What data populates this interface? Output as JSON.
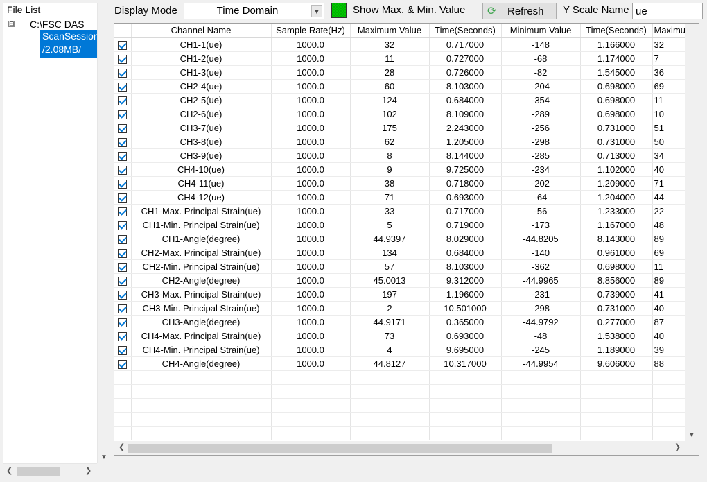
{
  "left_panel": {
    "header": "File List",
    "tree_root_label": "C:\\FSC DAS",
    "tree_expander": "⊟",
    "tree_child_line1": "ScanSession",
    "tree_child_line2": "/2.08MB/"
  },
  "toolbar": {
    "display_mode_label": "Display Mode",
    "display_mode_value": "Time Domain",
    "show_maxmin_label": "Show Max. & Min. Value",
    "show_maxmin_color": "#00c800",
    "refresh_label": "Refresh",
    "refresh_icon": "refresh-icon",
    "y_scale_label": "Y Scale Name",
    "y_scale_value": "ue"
  },
  "grid": {
    "columns": [
      "",
      "Channel Name",
      "Sample Rate(Hz)",
      "Maximum Value",
      "Time(Seconds)",
      "Minimum Value",
      "Time(Seconds)",
      "Maximum Value"
    ],
    "rows": [
      {
        "checked": true,
        "name": "CH1-1(ue)",
        "rate": "1000.0",
        "max": "32",
        "tmax": "0.717000",
        "min": "-148",
        "tmin": "1.166000",
        "extra": "32"
      },
      {
        "checked": true,
        "name": "CH1-2(ue)",
        "rate": "1000.0",
        "max": "11",
        "tmax": "0.727000",
        "min": "-68",
        "tmin": "1.174000",
        "extra": "7"
      },
      {
        "checked": true,
        "name": "CH1-3(ue)",
        "rate": "1000.0",
        "max": "28",
        "tmax": "0.726000",
        "min": "-82",
        "tmin": "1.545000",
        "extra": "36"
      },
      {
        "checked": true,
        "name": "CH2-4(ue)",
        "rate": "1000.0",
        "max": "60",
        "tmax": "8.103000",
        "min": "-204",
        "tmin": "0.698000",
        "extra": "69"
      },
      {
        "checked": true,
        "name": "CH2-5(ue)",
        "rate": "1000.0",
        "max": "124",
        "tmax": "0.684000",
        "min": "-354",
        "tmin": "0.698000",
        "extra": "11"
      },
      {
        "checked": true,
        "name": "CH2-6(ue)",
        "rate": "1000.0",
        "max": "102",
        "tmax": "8.109000",
        "min": "-289",
        "tmin": "0.698000",
        "extra": "10"
      },
      {
        "checked": true,
        "name": "CH3-7(ue)",
        "rate": "1000.0",
        "max": "175",
        "tmax": "2.243000",
        "min": "-256",
        "tmin": "0.731000",
        "extra": "51"
      },
      {
        "checked": true,
        "name": "CH3-8(ue)",
        "rate": "1000.0",
        "max": "62",
        "tmax": "1.205000",
        "min": "-298",
        "tmin": "0.731000",
        "extra": "50"
      },
      {
        "checked": true,
        "name": "CH3-9(ue)",
        "rate": "1000.0",
        "max": "8",
        "tmax": "8.144000",
        "min": "-285",
        "tmin": "0.713000",
        "extra": "34"
      },
      {
        "checked": true,
        "name": "CH4-10(ue)",
        "rate": "1000.0",
        "max": "9",
        "tmax": "9.725000",
        "min": "-234",
        "tmin": "1.102000",
        "extra": "40"
      },
      {
        "checked": true,
        "name": "CH4-11(ue)",
        "rate": "1000.0",
        "max": "38",
        "tmax": "0.718000",
        "min": "-202",
        "tmin": "1.209000",
        "extra": "71"
      },
      {
        "checked": true,
        "name": "CH4-12(ue)",
        "rate": "1000.0",
        "max": "71",
        "tmax": "0.693000",
        "min": "-64",
        "tmin": "1.204000",
        "extra": "44"
      },
      {
        "checked": true,
        "name": "CH1-Max. Principal Strain(ue)",
        "rate": "1000.0",
        "max": "33",
        "tmax": "0.717000",
        "min": "-56",
        "tmin": "1.233000",
        "extra": "22"
      },
      {
        "checked": true,
        "name": "CH1-Min. Principal Strain(ue)",
        "rate": "1000.0",
        "max": "5",
        "tmax": "0.719000",
        "min": "-173",
        "tmin": "1.167000",
        "extra": "48"
      },
      {
        "checked": true,
        "name": "CH1-Angle(degree)",
        "rate": "1000.0",
        "max": "44.9397",
        "tmax": "8.029000",
        "min": "-44.8205",
        "tmin": "8.143000",
        "extra": "89"
      },
      {
        "checked": true,
        "name": "CH2-Max. Principal Strain(ue)",
        "rate": "1000.0",
        "max": "134",
        "tmax": "0.684000",
        "min": "-140",
        "tmin": "0.961000",
        "extra": "69"
      },
      {
        "checked": true,
        "name": "CH2-Min. Principal Strain(ue)",
        "rate": "1000.0",
        "max": "57",
        "tmax": "8.103000",
        "min": "-362",
        "tmin": "0.698000",
        "extra": "11"
      },
      {
        "checked": true,
        "name": "CH2-Angle(degree)",
        "rate": "1000.0",
        "max": "45.0013",
        "tmax": "9.312000",
        "min": "-44.9965",
        "tmin": "8.856000",
        "extra": "89"
      },
      {
        "checked": true,
        "name": "CH3-Max. Principal Strain(ue)",
        "rate": "1000.0",
        "max": "197",
        "tmax": "1.196000",
        "min": "-231",
        "tmin": "0.739000",
        "extra": "41"
      },
      {
        "checked": true,
        "name": "CH3-Min. Principal Strain(ue)",
        "rate": "1000.0",
        "max": "2",
        "tmax": "10.501000",
        "min": "-298",
        "tmin": "0.731000",
        "extra": "40"
      },
      {
        "checked": true,
        "name": "CH3-Angle(degree)",
        "rate": "1000.0",
        "max": "44.9171",
        "tmax": "0.365000",
        "min": "-44.9792",
        "tmin": "0.277000",
        "extra": "87"
      },
      {
        "checked": true,
        "name": "CH4-Max. Principal Strain(ue)",
        "rate": "1000.0",
        "max": "73",
        "tmax": "0.693000",
        "min": "-48",
        "tmin": "1.538000",
        "extra": "40"
      },
      {
        "checked": true,
        "name": "CH4-Min. Principal Strain(ue)",
        "rate": "1000.0",
        "max": "4",
        "tmax": "9.695000",
        "min": "-245",
        "tmin": "1.189000",
        "extra": "39"
      },
      {
        "checked": true,
        "name": "CH4-Angle(degree)",
        "rate": "1000.0",
        "max": "44.8127",
        "tmax": "10.317000",
        "min": "-44.9954",
        "tmin": "9.606000",
        "extra": "88"
      }
    ],
    "empty_rows": 5
  }
}
